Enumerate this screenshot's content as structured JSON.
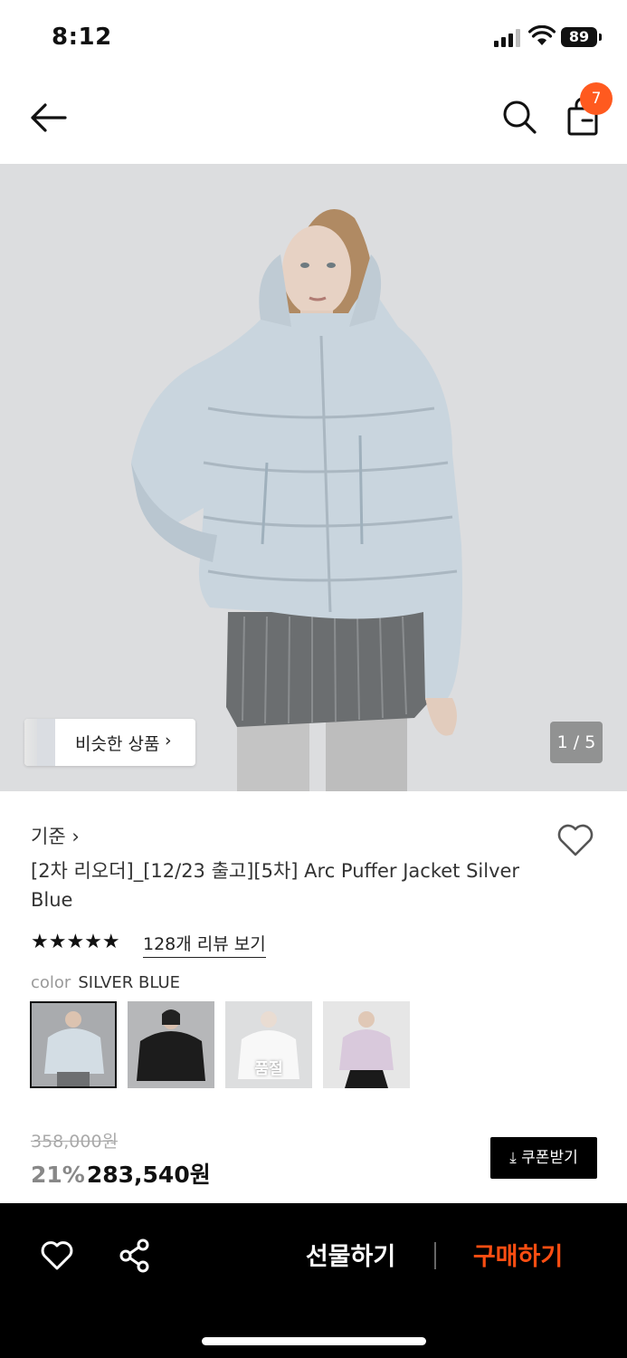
{
  "status_bar": {
    "time": "8:12",
    "battery": "89"
  },
  "nav": {
    "cart_badge": "7",
    "icons": [
      "back-arrow-icon",
      "search-icon",
      "shopping-bag-icon"
    ]
  },
  "hero": {
    "similar_label": "비슷한 상품",
    "similar_chevron": "›",
    "page_indicator": "1 / 5"
  },
  "product": {
    "brand": "기준 ›",
    "title": "[2차 리오더]_[12/23 출고][5차] Arc Puffer Jacket Silver Blue",
    "stars": "★★★★★",
    "rating_value": 5,
    "reviews_link": "128개 리뷰 보기",
    "color_label": "color",
    "color_value": "SILVER BLUE",
    "swatches": [
      {
        "name": "silver-blue",
        "selected": true,
        "color": "#cfd8df"
      },
      {
        "name": "black",
        "selected": false,
        "color": "#1c1c1c"
      },
      {
        "name": "white",
        "selected": false,
        "color": "#f2f2f2",
        "sold_out_label": "품절"
      },
      {
        "name": "lilac",
        "selected": false,
        "color": "#d9c9dc"
      }
    ],
    "original_price": "358,000원",
    "discount": "21%",
    "price": "283,540원",
    "coupon_label": "⤓ 쿠폰받기"
  },
  "bottom_bar": {
    "gift_label": "선물하기",
    "buy_label": "구매하기"
  },
  "colors": {
    "accent": "#ff4e12",
    "badge": "#ff5a1f",
    "jacket": "#c9d5de"
  }
}
